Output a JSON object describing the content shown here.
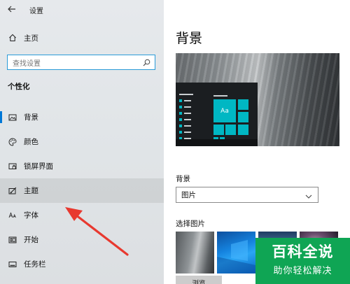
{
  "window": {
    "title": "设置"
  },
  "sidebar": {
    "home_label": "主页",
    "search": {
      "placeholder": "查找设置"
    },
    "section_title": "个性化",
    "items": [
      {
        "label": "背景",
        "icon": "picture-icon",
        "selected": true
      },
      {
        "label": "颜色",
        "icon": "palette-icon"
      },
      {
        "label": "锁屏界面",
        "icon": "lock-screen-icon"
      },
      {
        "label": "主题",
        "icon": "brush-icon",
        "hover": true
      },
      {
        "label": "字体",
        "icon": "font-icon"
      },
      {
        "label": "开始",
        "icon": "start-icon"
      },
      {
        "label": "任务栏",
        "icon": "taskbar-icon"
      }
    ]
  },
  "main": {
    "title": "背景",
    "preview": {
      "tile_text": "Aa"
    },
    "background_label": "背景",
    "background_select": {
      "value": "图片"
    },
    "choose_picture_label": "选择图片",
    "browse_label": "浏览"
  },
  "watermark": {
    "line1": "百科全说",
    "line2": "助你轻松解决"
  },
  "colors": {
    "accent": "#0078d7",
    "tile": "#00b7c3",
    "arrow": "#e8392f",
    "watermark_bg": "#0fa554"
  }
}
